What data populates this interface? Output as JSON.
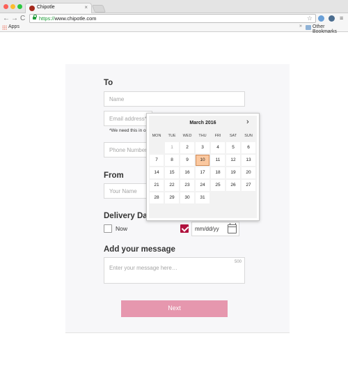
{
  "browser": {
    "tab_title": "Chipotle",
    "tab_close": "×",
    "url_scheme": "https://",
    "url_host": "www.chipotle.com",
    "bookmarks": {
      "apps_label": "Apps",
      "chevron": "»",
      "other": "Other Bookmarks"
    },
    "nav": {
      "back": "←",
      "forward": "→",
      "reload": "C"
    },
    "star": "☆",
    "menu": "≡"
  },
  "form": {
    "to_heading": "To",
    "name_placeholder": "Name",
    "email_placeholder": "Email address*",
    "email_note": "*We need this in or",
    "phone_placeholder": "Phone Number",
    "from_heading": "From",
    "your_name_placeholder": "Your Name",
    "delivery_heading": "Delivery Dat",
    "now_label": "Now",
    "date_placeholder": "mm/dd/yy",
    "message_heading": "Add your message",
    "message_placeholder": "Enter your message here…",
    "message_counter": "500",
    "next_label": "Next"
  },
  "datepicker": {
    "title": "March 2016",
    "next_icon": "›",
    "weekdays": [
      "MON",
      "TUE",
      "WED",
      "THU",
      "FRI",
      "SAT",
      "SUN"
    ],
    "selected_day": "10",
    "muted_days": [
      "1"
    ],
    "weeks": [
      [
        "",
        "1",
        "2",
        "3",
        "4",
        "5",
        "6"
      ],
      [
        "7",
        "8",
        "9",
        "10",
        "11",
        "12",
        "13"
      ],
      [
        "14",
        "15",
        "16",
        "17",
        "18",
        "19",
        "20"
      ],
      [
        "21",
        "22",
        "23",
        "24",
        "25",
        "26",
        "27"
      ],
      [
        "28",
        "29",
        "30",
        "31",
        "",
        "",
        ""
      ]
    ]
  },
  "colors": {
    "accent": "#b0123e",
    "next_button": "#e697ae",
    "selected_day": "#fbc89f"
  }
}
